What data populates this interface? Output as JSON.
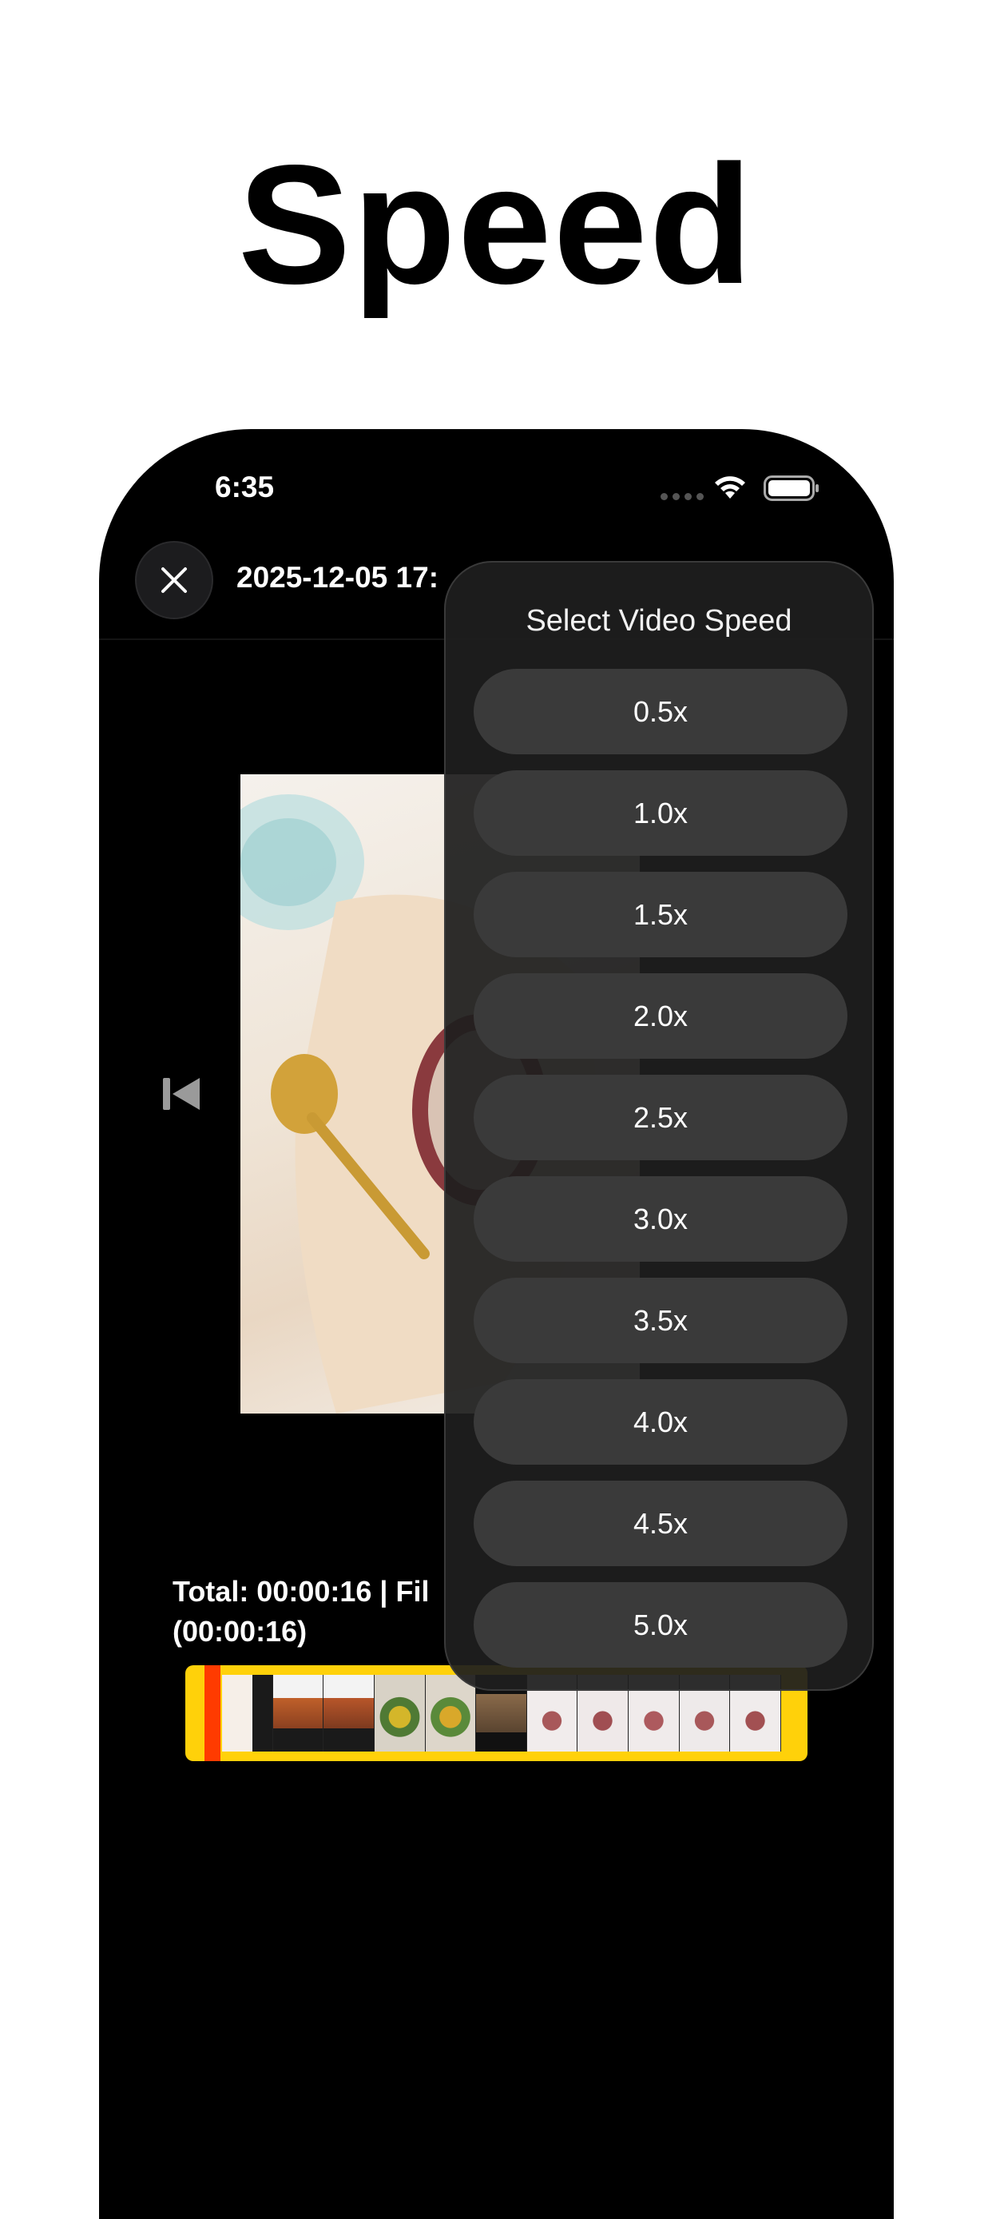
{
  "headline": "Speed",
  "status_bar": {
    "time": "6:35"
  },
  "nav": {
    "title": "2025-12-05 17:"
  },
  "player": {
    "info_line1": "Total: 00:00:16 | Fil",
    "info_line2": "(00:00:16)"
  },
  "speed_menu": {
    "title": "Select Video Speed",
    "options": [
      "0.5x",
      "1.0x",
      "1.5x",
      "2.0x",
      "2.5x",
      "3.0x",
      "3.5x",
      "4.0x",
      "4.5x",
      "5.0x"
    ]
  },
  "colors": {
    "timeline": "#ffd10a",
    "handle": "#ff3b00",
    "phone_bg": "#000000"
  }
}
